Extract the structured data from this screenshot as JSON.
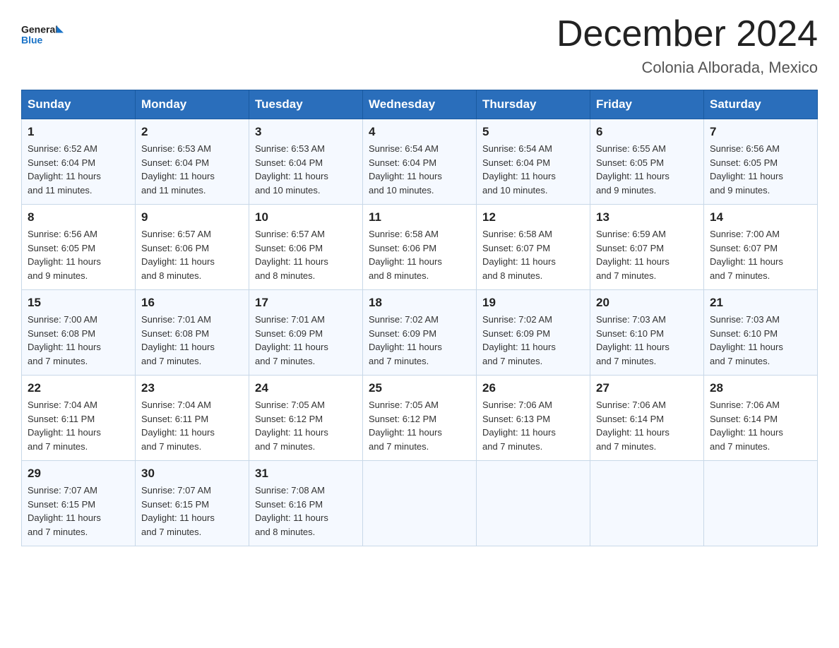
{
  "header": {
    "logo_general": "General",
    "logo_blue": "Blue",
    "month_title": "December 2024",
    "location": "Colonia Alborada, Mexico"
  },
  "weekdays": [
    "Sunday",
    "Monday",
    "Tuesday",
    "Wednesday",
    "Thursday",
    "Friday",
    "Saturday"
  ],
  "weeks": [
    [
      {
        "day": "1",
        "sunrise": "6:52 AM",
        "sunset": "6:04 PM",
        "daylight": "11 hours and 11 minutes."
      },
      {
        "day": "2",
        "sunrise": "6:53 AM",
        "sunset": "6:04 PM",
        "daylight": "11 hours and 11 minutes."
      },
      {
        "day": "3",
        "sunrise": "6:53 AM",
        "sunset": "6:04 PM",
        "daylight": "11 hours and 10 minutes."
      },
      {
        "day": "4",
        "sunrise": "6:54 AM",
        "sunset": "6:04 PM",
        "daylight": "11 hours and 10 minutes."
      },
      {
        "day": "5",
        "sunrise": "6:54 AM",
        "sunset": "6:04 PM",
        "daylight": "11 hours and 10 minutes."
      },
      {
        "day": "6",
        "sunrise": "6:55 AM",
        "sunset": "6:05 PM",
        "daylight": "11 hours and 9 minutes."
      },
      {
        "day": "7",
        "sunrise": "6:56 AM",
        "sunset": "6:05 PM",
        "daylight": "11 hours and 9 minutes."
      }
    ],
    [
      {
        "day": "8",
        "sunrise": "6:56 AM",
        "sunset": "6:05 PM",
        "daylight": "11 hours and 9 minutes."
      },
      {
        "day": "9",
        "sunrise": "6:57 AM",
        "sunset": "6:06 PM",
        "daylight": "11 hours and 8 minutes."
      },
      {
        "day": "10",
        "sunrise": "6:57 AM",
        "sunset": "6:06 PM",
        "daylight": "11 hours and 8 minutes."
      },
      {
        "day": "11",
        "sunrise": "6:58 AM",
        "sunset": "6:06 PM",
        "daylight": "11 hours and 8 minutes."
      },
      {
        "day": "12",
        "sunrise": "6:58 AM",
        "sunset": "6:07 PM",
        "daylight": "11 hours and 8 minutes."
      },
      {
        "day": "13",
        "sunrise": "6:59 AM",
        "sunset": "6:07 PM",
        "daylight": "11 hours and 7 minutes."
      },
      {
        "day": "14",
        "sunrise": "7:00 AM",
        "sunset": "6:07 PM",
        "daylight": "11 hours and 7 minutes."
      }
    ],
    [
      {
        "day": "15",
        "sunrise": "7:00 AM",
        "sunset": "6:08 PM",
        "daylight": "11 hours and 7 minutes."
      },
      {
        "day": "16",
        "sunrise": "7:01 AM",
        "sunset": "6:08 PM",
        "daylight": "11 hours and 7 minutes."
      },
      {
        "day": "17",
        "sunrise": "7:01 AM",
        "sunset": "6:09 PM",
        "daylight": "11 hours and 7 minutes."
      },
      {
        "day": "18",
        "sunrise": "7:02 AM",
        "sunset": "6:09 PM",
        "daylight": "11 hours and 7 minutes."
      },
      {
        "day": "19",
        "sunrise": "7:02 AM",
        "sunset": "6:09 PM",
        "daylight": "11 hours and 7 minutes."
      },
      {
        "day": "20",
        "sunrise": "7:03 AM",
        "sunset": "6:10 PM",
        "daylight": "11 hours and 7 minutes."
      },
      {
        "day": "21",
        "sunrise": "7:03 AM",
        "sunset": "6:10 PM",
        "daylight": "11 hours and 7 minutes."
      }
    ],
    [
      {
        "day": "22",
        "sunrise": "7:04 AM",
        "sunset": "6:11 PM",
        "daylight": "11 hours and 7 minutes."
      },
      {
        "day": "23",
        "sunrise": "7:04 AM",
        "sunset": "6:11 PM",
        "daylight": "11 hours and 7 minutes."
      },
      {
        "day": "24",
        "sunrise": "7:05 AM",
        "sunset": "6:12 PM",
        "daylight": "11 hours and 7 minutes."
      },
      {
        "day": "25",
        "sunrise": "7:05 AM",
        "sunset": "6:12 PM",
        "daylight": "11 hours and 7 minutes."
      },
      {
        "day": "26",
        "sunrise": "7:06 AM",
        "sunset": "6:13 PM",
        "daylight": "11 hours and 7 minutes."
      },
      {
        "day": "27",
        "sunrise": "7:06 AM",
        "sunset": "6:14 PM",
        "daylight": "11 hours and 7 minutes."
      },
      {
        "day": "28",
        "sunrise": "7:06 AM",
        "sunset": "6:14 PM",
        "daylight": "11 hours and 7 minutes."
      }
    ],
    [
      {
        "day": "29",
        "sunrise": "7:07 AM",
        "sunset": "6:15 PM",
        "daylight": "11 hours and 7 minutes."
      },
      {
        "day": "30",
        "sunrise": "7:07 AM",
        "sunset": "6:15 PM",
        "daylight": "11 hours and 7 minutes."
      },
      {
        "day": "31",
        "sunrise": "7:08 AM",
        "sunset": "6:16 PM",
        "daylight": "11 hours and 8 minutes."
      },
      null,
      null,
      null,
      null
    ]
  ],
  "labels": {
    "sunrise": "Sunrise:",
    "sunset": "Sunset:",
    "daylight": "Daylight:"
  }
}
